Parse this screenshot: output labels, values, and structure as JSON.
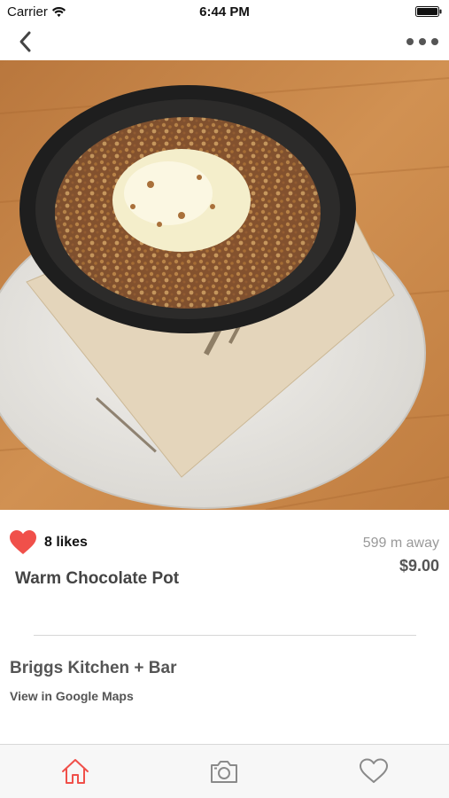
{
  "status_bar": {
    "carrier": "Carrier",
    "time": "6:44 PM"
  },
  "nav": {
    "back_icon": "chevron-left-icon",
    "more_icon": "ellipsis-icon"
  },
  "photo": {
    "description_icon": "food-photo"
  },
  "dish": {
    "likes": "8 likes",
    "name": "Warm Chocolate Pot",
    "distance": "599 m away",
    "price": "$9.00",
    "liked": true
  },
  "restaurant": {
    "name": "Briggs Kitchen + Bar",
    "maps_link": "View in Google Maps"
  },
  "tabs": [
    {
      "name": "home",
      "icon": "home-icon",
      "active": true
    },
    {
      "name": "camera",
      "icon": "camera-icon",
      "active": false
    },
    {
      "name": "favorites",
      "icon": "heart-outline-icon",
      "active": false
    }
  ],
  "colors": {
    "accent": "#f0504a",
    "tab_inactive": "#8a8a8a",
    "text_dark": "#444444",
    "text_muted": "#999999"
  }
}
